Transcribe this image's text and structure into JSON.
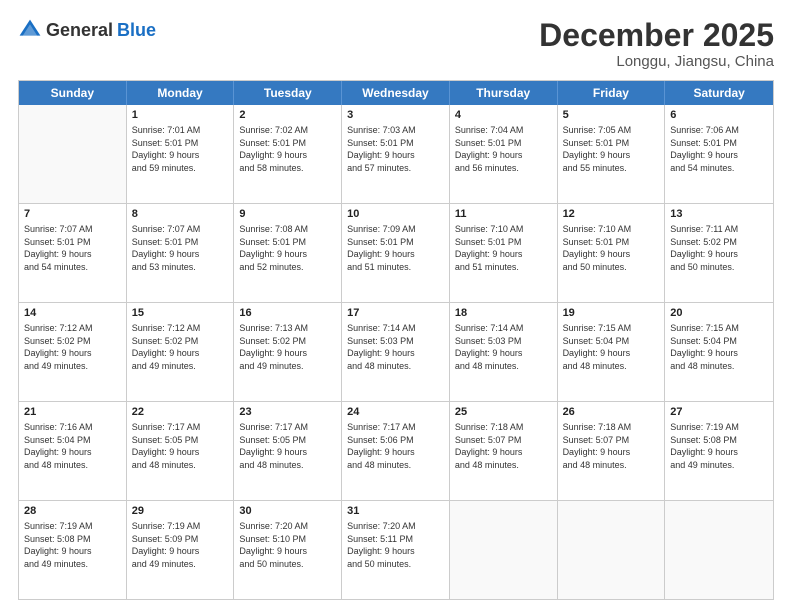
{
  "logo": {
    "text_general": "General",
    "text_blue": "Blue"
  },
  "title": "December 2025",
  "location": "Longgu, Jiangsu, China",
  "header_days": [
    "Sunday",
    "Monday",
    "Tuesday",
    "Wednesday",
    "Thursday",
    "Friday",
    "Saturday"
  ],
  "weeks": [
    [
      {
        "day": "",
        "info": ""
      },
      {
        "day": "1",
        "info": "Sunrise: 7:01 AM\nSunset: 5:01 PM\nDaylight: 9 hours\nand 59 minutes."
      },
      {
        "day": "2",
        "info": "Sunrise: 7:02 AM\nSunset: 5:01 PM\nDaylight: 9 hours\nand 58 minutes."
      },
      {
        "day": "3",
        "info": "Sunrise: 7:03 AM\nSunset: 5:01 PM\nDaylight: 9 hours\nand 57 minutes."
      },
      {
        "day": "4",
        "info": "Sunrise: 7:04 AM\nSunset: 5:01 PM\nDaylight: 9 hours\nand 56 minutes."
      },
      {
        "day": "5",
        "info": "Sunrise: 7:05 AM\nSunset: 5:01 PM\nDaylight: 9 hours\nand 55 minutes."
      },
      {
        "day": "6",
        "info": "Sunrise: 7:06 AM\nSunset: 5:01 PM\nDaylight: 9 hours\nand 54 minutes."
      }
    ],
    [
      {
        "day": "7",
        "info": "Sunrise: 7:07 AM\nSunset: 5:01 PM\nDaylight: 9 hours\nand 54 minutes."
      },
      {
        "day": "8",
        "info": "Sunrise: 7:07 AM\nSunset: 5:01 PM\nDaylight: 9 hours\nand 53 minutes."
      },
      {
        "day": "9",
        "info": "Sunrise: 7:08 AM\nSunset: 5:01 PM\nDaylight: 9 hours\nand 52 minutes."
      },
      {
        "day": "10",
        "info": "Sunrise: 7:09 AM\nSunset: 5:01 PM\nDaylight: 9 hours\nand 51 minutes."
      },
      {
        "day": "11",
        "info": "Sunrise: 7:10 AM\nSunset: 5:01 PM\nDaylight: 9 hours\nand 51 minutes."
      },
      {
        "day": "12",
        "info": "Sunrise: 7:10 AM\nSunset: 5:01 PM\nDaylight: 9 hours\nand 50 minutes."
      },
      {
        "day": "13",
        "info": "Sunrise: 7:11 AM\nSunset: 5:02 PM\nDaylight: 9 hours\nand 50 minutes."
      }
    ],
    [
      {
        "day": "14",
        "info": "Sunrise: 7:12 AM\nSunset: 5:02 PM\nDaylight: 9 hours\nand 49 minutes."
      },
      {
        "day": "15",
        "info": "Sunrise: 7:12 AM\nSunset: 5:02 PM\nDaylight: 9 hours\nand 49 minutes."
      },
      {
        "day": "16",
        "info": "Sunrise: 7:13 AM\nSunset: 5:02 PM\nDaylight: 9 hours\nand 49 minutes."
      },
      {
        "day": "17",
        "info": "Sunrise: 7:14 AM\nSunset: 5:03 PM\nDaylight: 9 hours\nand 48 minutes."
      },
      {
        "day": "18",
        "info": "Sunrise: 7:14 AM\nSunset: 5:03 PM\nDaylight: 9 hours\nand 48 minutes."
      },
      {
        "day": "19",
        "info": "Sunrise: 7:15 AM\nSunset: 5:04 PM\nDaylight: 9 hours\nand 48 minutes."
      },
      {
        "day": "20",
        "info": "Sunrise: 7:15 AM\nSunset: 5:04 PM\nDaylight: 9 hours\nand 48 minutes."
      }
    ],
    [
      {
        "day": "21",
        "info": "Sunrise: 7:16 AM\nSunset: 5:04 PM\nDaylight: 9 hours\nand 48 minutes."
      },
      {
        "day": "22",
        "info": "Sunrise: 7:17 AM\nSunset: 5:05 PM\nDaylight: 9 hours\nand 48 minutes."
      },
      {
        "day": "23",
        "info": "Sunrise: 7:17 AM\nSunset: 5:05 PM\nDaylight: 9 hours\nand 48 minutes."
      },
      {
        "day": "24",
        "info": "Sunrise: 7:17 AM\nSunset: 5:06 PM\nDaylight: 9 hours\nand 48 minutes."
      },
      {
        "day": "25",
        "info": "Sunrise: 7:18 AM\nSunset: 5:07 PM\nDaylight: 9 hours\nand 48 minutes."
      },
      {
        "day": "26",
        "info": "Sunrise: 7:18 AM\nSunset: 5:07 PM\nDaylight: 9 hours\nand 48 minutes."
      },
      {
        "day": "27",
        "info": "Sunrise: 7:19 AM\nSunset: 5:08 PM\nDaylight: 9 hours\nand 49 minutes."
      }
    ],
    [
      {
        "day": "28",
        "info": "Sunrise: 7:19 AM\nSunset: 5:08 PM\nDaylight: 9 hours\nand 49 minutes."
      },
      {
        "day": "29",
        "info": "Sunrise: 7:19 AM\nSunset: 5:09 PM\nDaylight: 9 hours\nand 49 minutes."
      },
      {
        "day": "30",
        "info": "Sunrise: 7:20 AM\nSunset: 5:10 PM\nDaylight: 9 hours\nand 50 minutes."
      },
      {
        "day": "31",
        "info": "Sunrise: 7:20 AM\nSunset: 5:11 PM\nDaylight: 9 hours\nand 50 minutes."
      },
      {
        "day": "",
        "info": ""
      },
      {
        "day": "",
        "info": ""
      },
      {
        "day": "",
        "info": ""
      }
    ]
  ]
}
